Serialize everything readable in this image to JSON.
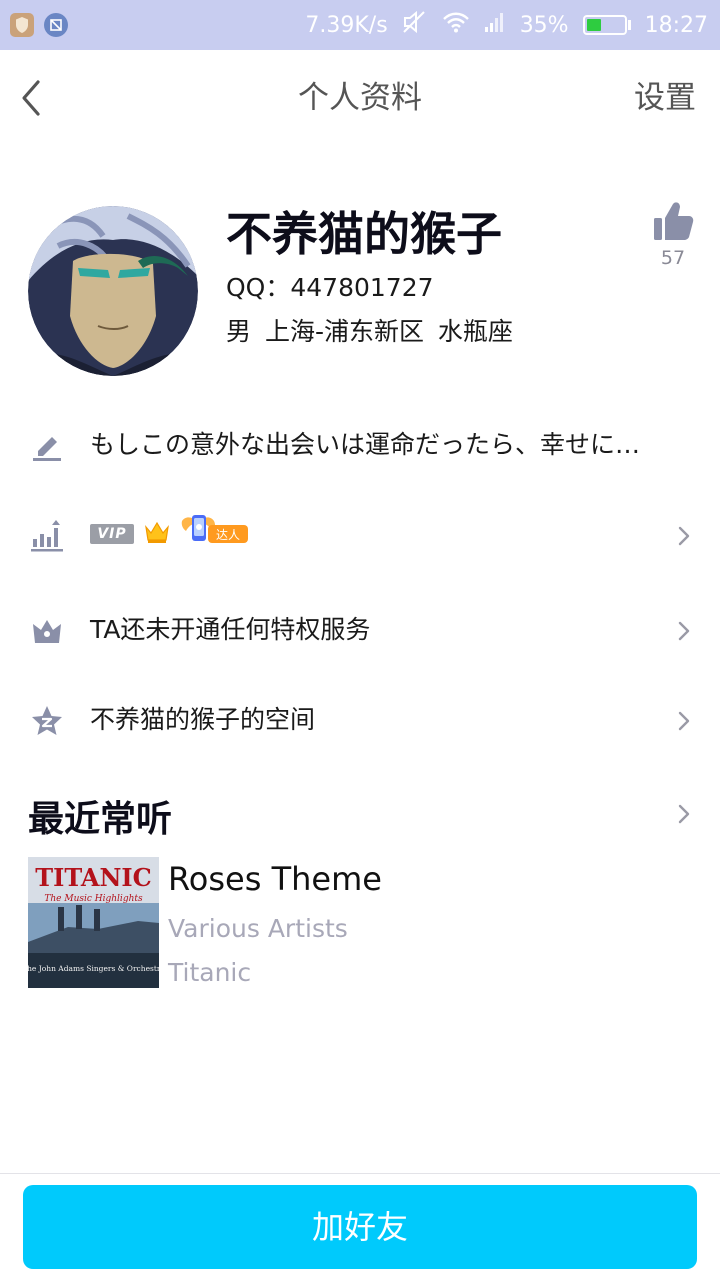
{
  "status_bar": {
    "speed": "7.39K/s",
    "battery_percent": "35%",
    "battery_level": 0.35,
    "time": "18:27",
    "icons": [
      "app-shield-icon",
      "app-image-icon",
      "mute-icon",
      "wifi-icon",
      "signal-icon",
      "battery-icon"
    ]
  },
  "header": {
    "title": "个人资料",
    "settings_label": "设置",
    "back_icon": "chevron-left-icon"
  },
  "profile": {
    "nickname": "不养猫的猴子",
    "qq": "QQ：447801727",
    "info": "男 上海-浦东新区 水瓶座",
    "like_count": "57",
    "like_icon": "thumbs-up-icon"
  },
  "signature": {
    "text": "もしこの意外な出会いは運命だったら、幸せに…",
    "icon": "pencil-icon"
  },
  "level_row": {
    "icon": "level-chart-icon",
    "vip_label": "VIP",
    "badge_label": "达人"
  },
  "privilege_row": {
    "text": "TA还未开通任何特权服务",
    "icon": "crown-icon"
  },
  "qzone_row": {
    "text": "不养猫的猴子的空间",
    "icon": "qzone-star-icon"
  },
  "recent": {
    "title": "最近常听",
    "song": {
      "title": "Roses Theme",
      "artist": "Various Artists",
      "album": "Titanic",
      "cover_title": "TITANIC",
      "cover_subtitle": "The Music Highlights",
      "cover_credit": "The John Adams Singers & Orchestra"
    }
  },
  "footer": {
    "add_friend_label": "加好友"
  },
  "colors": {
    "status_bar_bg": "#c8cdf0",
    "accent": "#00cafc",
    "icon_gray": "#8a8fa8",
    "secondary_text": "#a8a8b8"
  }
}
